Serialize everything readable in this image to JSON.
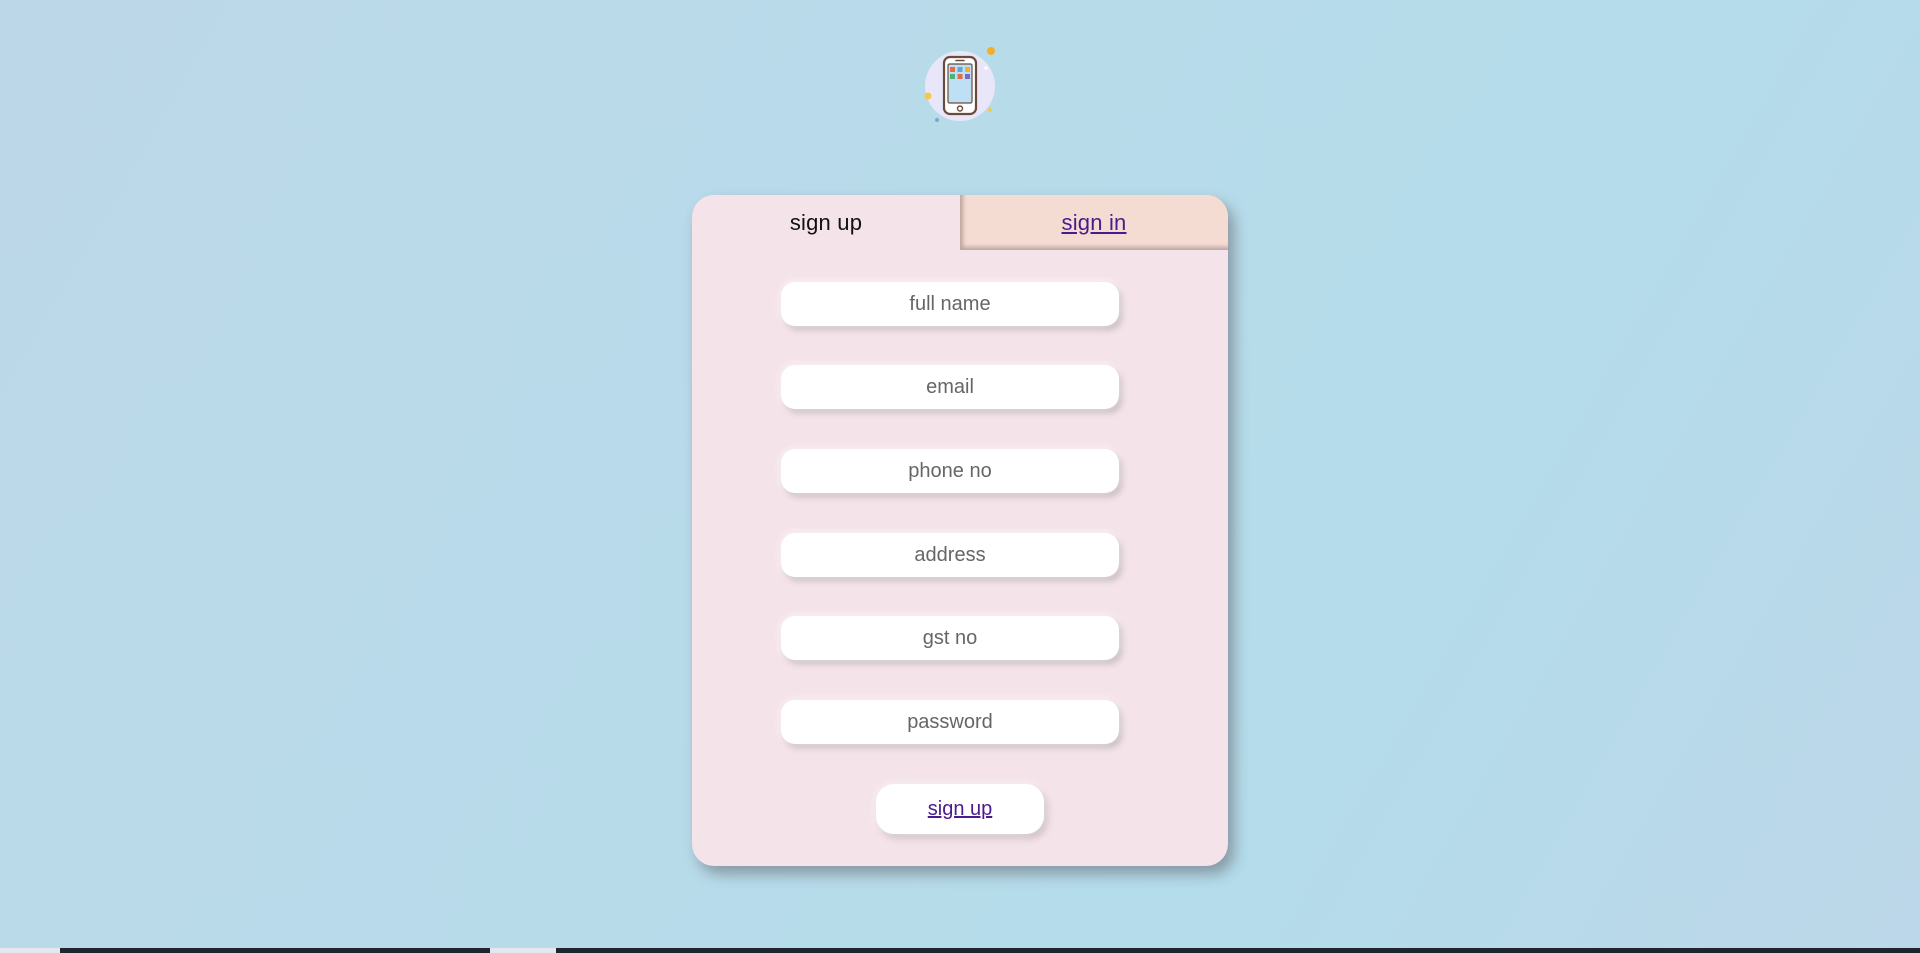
{
  "logo": {
    "icon": "smartphone-icon"
  },
  "tabs": {
    "signup_label": "sign up",
    "signin_label": "sign in"
  },
  "form": {
    "fields": [
      {
        "name": "full-name-input",
        "placeholder": "full name",
        "value": ""
      },
      {
        "name": "email-input",
        "placeholder": "email",
        "value": ""
      },
      {
        "name": "phone-input",
        "placeholder": "phone no",
        "value": ""
      },
      {
        "name": "address-input",
        "placeholder": "address",
        "value": ""
      },
      {
        "name": "gst-input",
        "placeholder": "gst no",
        "value": ""
      },
      {
        "name": "password-input",
        "placeholder": "password",
        "value": ""
      }
    ],
    "submit_label": "sign up"
  },
  "colors": {
    "card_background": "#f4e3e9",
    "signin_tab_background": "#f5dcd2",
    "link": "#4b1a8c",
    "page_background": "#b8dbea"
  }
}
